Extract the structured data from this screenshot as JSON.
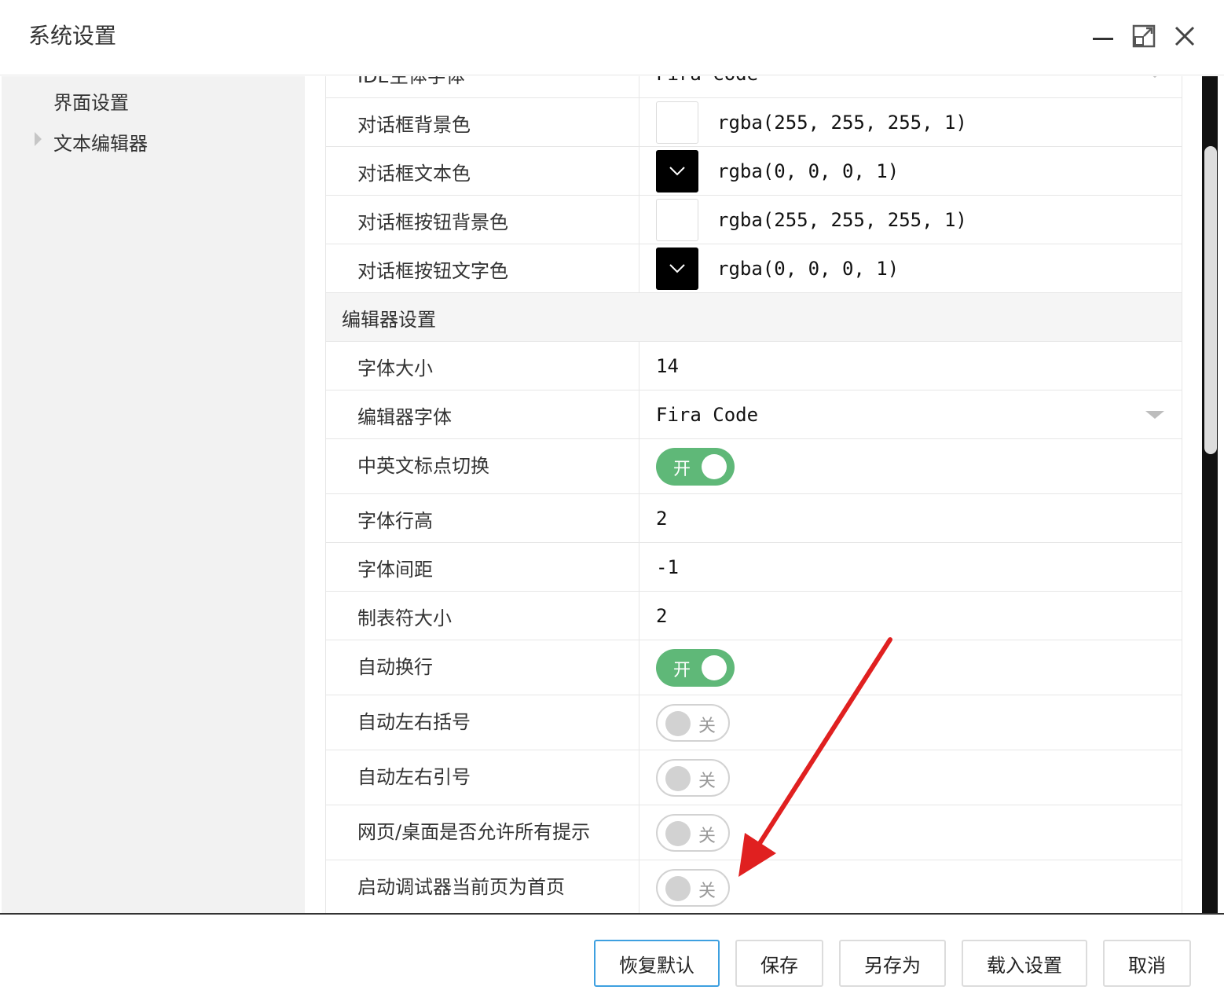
{
  "window": {
    "title": "系统设置"
  },
  "sidebar": {
    "items": [
      {
        "label": "界面设置"
      },
      {
        "label": "文本编辑器"
      }
    ]
  },
  "settings": {
    "partial_top": {
      "label": "IDE主体字体",
      "value": "Fira Code"
    },
    "dialog_bg": {
      "label": "对话框背景色",
      "value": "rgba(255, 255, 255, 1)"
    },
    "dialog_text": {
      "label": "对话框文本色",
      "value": "rgba(0, 0, 0, 1)"
    },
    "dialog_btn_bg": {
      "label": "对话框按钮背景色",
      "value": "rgba(255, 255, 255, 1)"
    },
    "dialog_btn_text": {
      "label": "对话框按钮文字色",
      "value": "rgba(0, 0, 0, 1)"
    },
    "editor_section": "编辑器设置",
    "font_size": {
      "label": "字体大小",
      "value": "14"
    },
    "editor_font": {
      "label": "编辑器字体",
      "value": "Fira Code"
    },
    "punct_switch": {
      "label": "中英文标点切换",
      "state": "开"
    },
    "line_height": {
      "label": "字体行高",
      "value": "2"
    },
    "letter_spacing": {
      "label": "字体间距",
      "value": "-1"
    },
    "tab_size": {
      "label": "制表符大小",
      "value": "2"
    },
    "auto_wrap": {
      "label": "自动换行",
      "state": "开"
    },
    "auto_brackets": {
      "label": "自动左右括号",
      "state": "关"
    },
    "auto_quotes": {
      "label": "自动左右引号",
      "state": "关"
    },
    "allow_hints": {
      "label": "网页/桌面是否允许所有提示",
      "state": "关"
    },
    "debugger_home": {
      "label": "启动调试器当前页为首页",
      "state": "关"
    }
  },
  "footer": {
    "restore_default": "恢复默认",
    "save": "保存",
    "save_as": "另存为",
    "load": "载入设置",
    "cancel": "取消"
  },
  "colors": {
    "toggle_on": "#5fb878",
    "primary_border": "#3ea0e0",
    "annotation_arrow": "#e02020"
  }
}
